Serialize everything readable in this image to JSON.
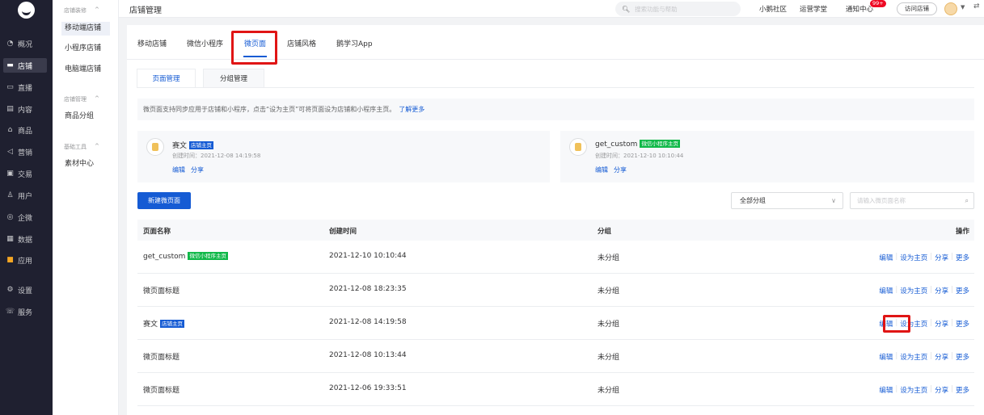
{
  "rail": {
    "items": [
      {
        "icon": "◔",
        "label": "概况"
      },
      {
        "icon": "▬",
        "label": "店铺",
        "active": true
      },
      {
        "icon": "▭",
        "label": "直播"
      },
      {
        "icon": "▤",
        "label": "内容"
      },
      {
        "icon": "⌂",
        "label": "商品"
      },
      {
        "icon": "◁",
        "label": "营销"
      },
      {
        "icon": "▣",
        "label": "交易"
      },
      {
        "icon": "♙",
        "label": "用户"
      },
      {
        "icon": "◎",
        "label": "企微"
      },
      {
        "icon": "▦",
        "label": "数据"
      },
      {
        "icon": "■",
        "label": "应用"
      },
      {
        "icon": "⚙",
        "label": "设置"
      },
      {
        "icon": "☏",
        "label": "服务"
      }
    ]
  },
  "sub_sidebar": {
    "group1": {
      "label": "店铺装修",
      "chevron": "^"
    },
    "items1": [
      "移动端店铺",
      "小程序店铺",
      "电脑端店铺"
    ],
    "group2": {
      "label": "店铺管理",
      "chevron": "^"
    },
    "items2": [
      "商品分组"
    ],
    "group3": {
      "label": "基础工具",
      "chevron": "^"
    },
    "items3": [
      "素材中心"
    ]
  },
  "topbar": {
    "title": "店铺管理",
    "search_placeholder": "搜索功能与帮助",
    "links": [
      "小鹅社区",
      "运营学堂",
      "通知中心"
    ],
    "notify_badge": "99+",
    "visit_label": "访问店铺"
  },
  "tabs": [
    "移动店铺",
    "微信小程序",
    "微页面",
    "店铺风格",
    "鹅学习App"
  ],
  "sub_tabs": [
    "页面管理",
    "分组管理"
  ],
  "notice": {
    "text": "微页面支持同步应用于店铺和小程序，点击“设为主页”可将页面设为店铺和小程序主页。",
    "more": "了解更多"
  },
  "home_cards": [
    {
      "name": "赛文",
      "tag": "店铺主页",
      "time": "创建时间：2021-12-08 14:19:58",
      "actions": [
        "编辑",
        "分享"
      ]
    },
    {
      "name": "get_custom",
      "tag": "微信小程序主页",
      "time": "创建时间：2021-12-10 10:10:44",
      "actions": [
        "编辑",
        "分享"
      ]
    }
  ],
  "toolbar": {
    "new_label": "新建微页面",
    "group_select": "全部分组",
    "search_placeholder": "请输入微页面名称"
  },
  "table": {
    "headers": {
      "name": "页面名称",
      "created": "创建时间",
      "group": "分组",
      "ops": "操作"
    },
    "ops": [
      "编辑",
      "设为主页",
      "分享",
      "更多"
    ],
    "rows": [
      {
        "name": "get_custom",
        "tag": "微信小程序主页",
        "tag_color": "green",
        "created": "2021-12-10 10:10:44",
        "group": "未分组"
      },
      {
        "name": "微页面标题",
        "tag": "",
        "created": "2021-12-08 18:23:35",
        "group": "未分组"
      },
      {
        "name": "赛文",
        "tag": "店铺主页",
        "tag_color": "blue",
        "created": "2021-12-08 14:19:58",
        "group": "未分组"
      },
      {
        "name": "微页面标题",
        "tag": "",
        "created": "2021-12-08 10:13:44",
        "group": "未分组"
      },
      {
        "name": "微页面标题",
        "tag": "",
        "created": "2021-12-06 19:33:51",
        "group": "未分组"
      }
    ]
  },
  "colors": {
    "accent": "#155bd4",
    "rail": "#1f2030",
    "highlight": "#e01515",
    "tag_green": "#0fb848"
  }
}
